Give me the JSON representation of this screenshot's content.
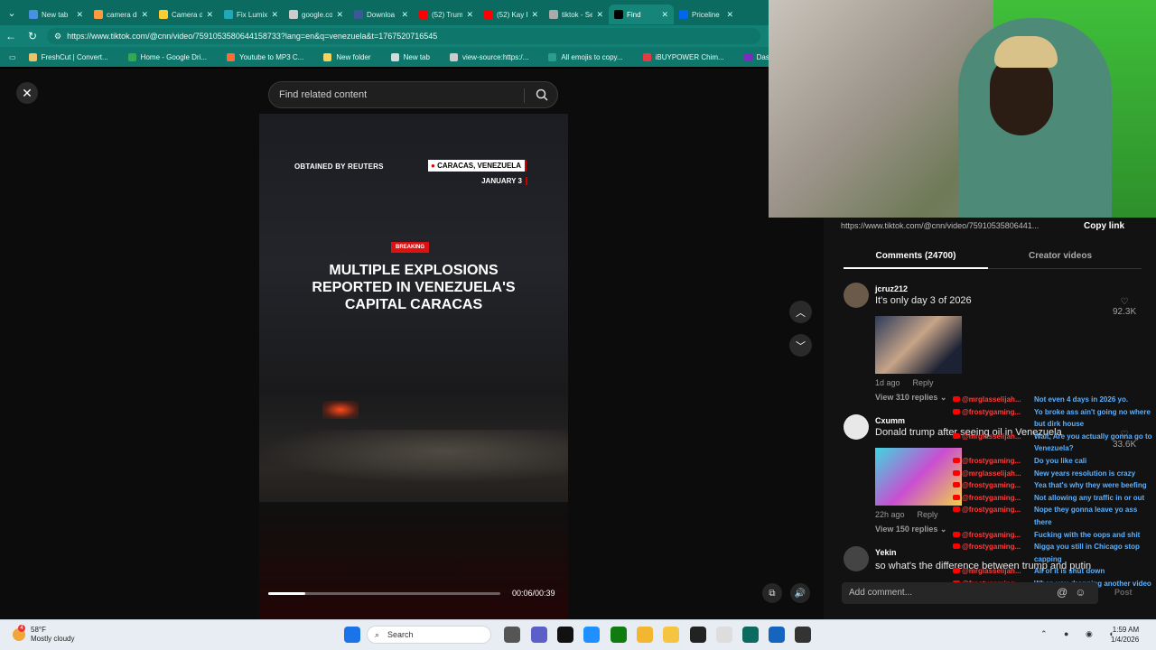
{
  "browser": {
    "tabs": [
      {
        "label": "New tab",
        "color": "#4a90e2"
      },
      {
        "label": "camera di",
        "color": "#ff9a3c"
      },
      {
        "label": "Camera di",
        "color": "#ffcc33"
      },
      {
        "label": "Fix Lumix",
        "color": "#1fa8b8"
      },
      {
        "label": "google.co",
        "color": "#cccccc"
      },
      {
        "label": "Downloa",
        "color": "#3b5998"
      },
      {
        "label": "(52) Trum",
        "color": "#ff0000"
      },
      {
        "label": "(52) Kay F",
        "color": "#ff0000"
      },
      {
        "label": "tiktok - Se",
        "color": "#aaaaaa"
      },
      {
        "label": "Find",
        "color": "#000000"
      },
      {
        "label": "Priceline",
        "color": "#0068ef"
      }
    ],
    "url": "https://www.tiktok.com/@cnn/video/7591053580644158733?lang=en&q=venezuela&t=1767520716545",
    "bookmarks": [
      {
        "label": "FreshCut | Convert...",
        "color": "#e9c46a"
      },
      {
        "label": "Home - Google Dri...",
        "color": "#34a853"
      },
      {
        "label": "Youtube to MP3 C...",
        "color": "#ff6b35"
      },
      {
        "label": "New folder",
        "color": "#f4d35e"
      },
      {
        "label": "New tab",
        "color": "#d9d9d9"
      },
      {
        "label": "view-source:https:/...",
        "color": "#cccccc"
      },
      {
        "label": "All emojis to copy...",
        "color": "#2a9d8f"
      },
      {
        "label": "iBUYPOWER Chim...",
        "color": "#e63946"
      },
      {
        "label": "Dashboard | Stre...",
        "color": "#7b2cbf"
      }
    ]
  },
  "tiktok": {
    "search_placeholder": "Find related content",
    "video": {
      "source": "OBTAINED BY REUTERS",
      "location": "CARACAS, VENEZUELA",
      "date": "JANUARY 3",
      "badge": "BREAKING",
      "headline": "MULTIPLE EXPLOSIONS REPORTED IN VENEZUELA'S CAPITAL CARACAS",
      "time": "00:06/00:39",
      "progress": 0.16
    },
    "share_url": "https://www.tiktok.com/@cnn/video/75910535806441...",
    "copy_link": "Copy link",
    "tabs": {
      "comments": "Comments (24700)",
      "creator": "Creator videos"
    },
    "comments": [
      {
        "user": "jcruz212",
        "text": "It's only day 3 of 2026",
        "time": "1d ago",
        "reply": "Reply",
        "replies": "View 310 replies",
        "likes": "92.3K"
      },
      {
        "user": "Cxumm",
        "text": "Donald trump after seeing oil in Venezuela",
        "time": "22h ago",
        "reply": "Reply",
        "replies": "View 150 replies",
        "likes": "33.6K"
      },
      {
        "user": "Yekin",
        "text": "so what's the difference between trump and putin"
      }
    ],
    "add_comment": "Add comment...",
    "post": "Post"
  },
  "chat": [
    {
      "name": "@mrglasselijah...",
      "msg": "Not even 4 days in 2026 yo."
    },
    {
      "name": "@frostygaming...",
      "msg": "Yo broke ass ain't going no where but dirk house"
    },
    {
      "name": "@mrglasselijah...",
      "msg": "Wait, Are you actually gonna go to Venezuela?"
    },
    {
      "name": "@frostygaming...",
      "msg": "Do you like cali"
    },
    {
      "name": "@mrglasselijah...",
      "msg": "New years resolution is crazy"
    },
    {
      "name": "@frostygaming...",
      "msg": "Yea that's why they were beefing"
    },
    {
      "name": "@frostygaming...",
      "msg": "Not allowing any traffic in or out"
    },
    {
      "name": "@frostygaming...",
      "msg": "Nope they gonna leave yo ass there"
    },
    {
      "name": "@frostygaming...",
      "msg": "Fucking with the oops and shit"
    },
    {
      "name": "@frostygaming...",
      "msg": "Nigga you still in Chicago stop capping"
    },
    {
      "name": "@mrglasselijah...",
      "msg": "All of it is shut down"
    },
    {
      "name": "@frostygaming...",
      "msg": "When you dropping another video"
    }
  ],
  "taskbar": {
    "temp": "58°F",
    "weather": "Mostly cloudy",
    "weather_badge": "4",
    "search": "Search",
    "time": "1:59 AM",
    "date": "1/4/2026"
  }
}
